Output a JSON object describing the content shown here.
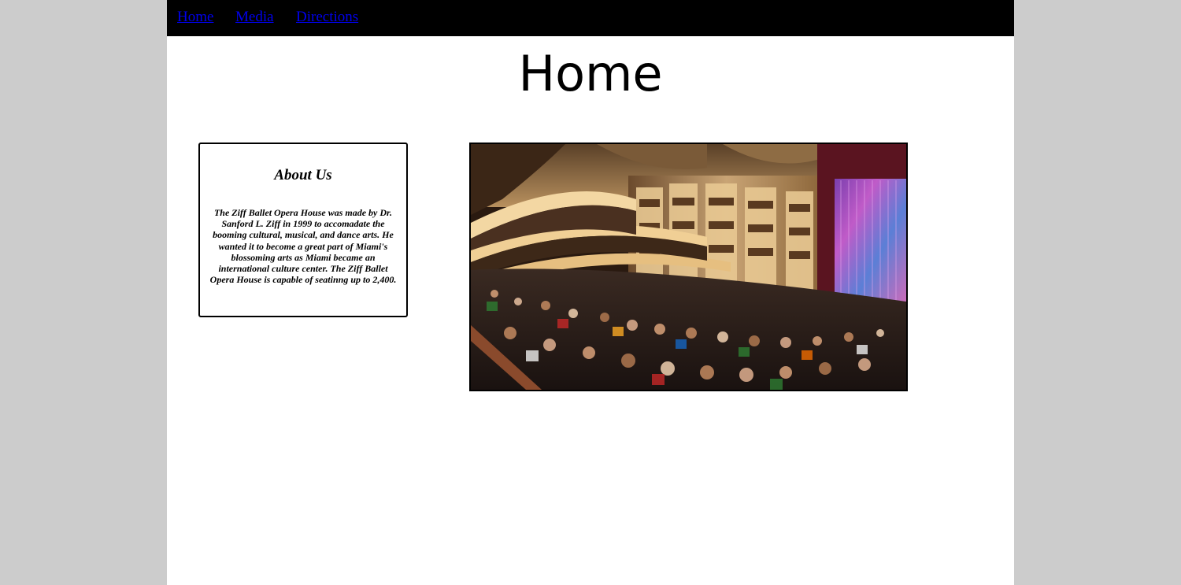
{
  "nav": {
    "links": [
      {
        "label": "Home"
      },
      {
        "label": "Media"
      },
      {
        "label": "Directions"
      }
    ]
  },
  "page": {
    "title": "Home"
  },
  "about": {
    "heading": "About Us",
    "body": "The Ziff Ballet Opera House was made by Dr. Sanford L. Ziff in 1999 to accomadate the booming cultural, musical, and dance arts. He wanted it to become a great part of Miami's blossoming arts as Miami became an international culture center. The Ziff Ballet Opera House is capable of seatinng up to 2,400."
  },
  "hero_image": {
    "subject": "opera-house-auditorium-photo"
  },
  "colors": {
    "background": "#cccccc",
    "page": "#ffffff",
    "navbar": "#000000",
    "link": "#0000ee"
  }
}
